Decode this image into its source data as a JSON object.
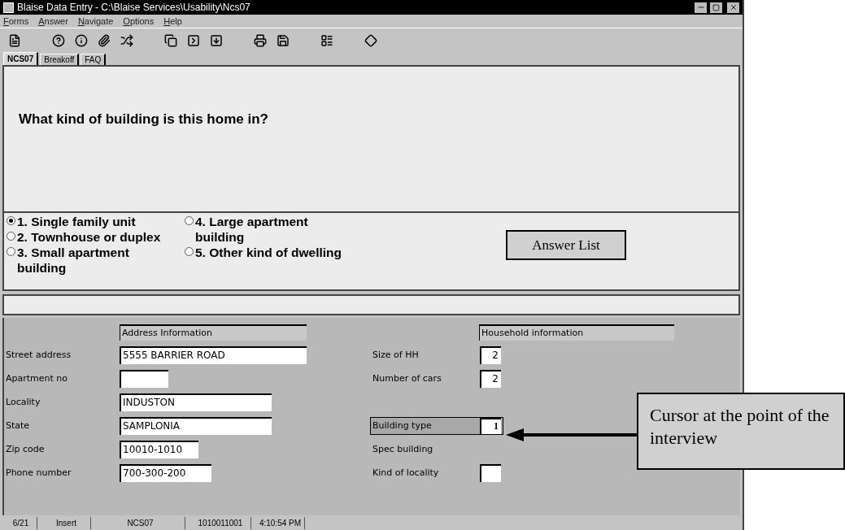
{
  "window": {
    "title": "Blaise Data Entry - C:\\Blaise Services\\Usability\\Ncs07"
  },
  "menu": [
    {
      "label": "Forms"
    },
    {
      "label": "Answer"
    },
    {
      "label": "Navigate"
    },
    {
      "label": "Options"
    },
    {
      "label": "Help"
    }
  ],
  "tabs": [
    {
      "label": "NCS07",
      "selected": true
    },
    {
      "label": "Breakoff",
      "selected": false
    },
    {
      "label": "FAQ",
      "selected": false
    }
  ],
  "question": "What kind of building is this home in?",
  "answer_columns": [
    [
      {
        "label": "1. Single family unit",
        "selected": true
      },
      {
        "label": "2. Townhouse or duplex",
        "selected": false
      },
      {
        "label": "3. Small apartment building",
        "selected": false
      }
    ],
    [
      {
        "label": "4. Large apartment building",
        "selected": false
      },
      {
        "label": "5. Other kind of dwelling",
        "selected": false
      }
    ]
  ],
  "address": {
    "heading": "Address Information",
    "fields": [
      {
        "label": "Street address",
        "value": "5555 BARRIER ROAD"
      },
      {
        "label": "Apartment no"
      },
      {
        "label": "Locality",
        "value": "INDUSTON"
      },
      {
        "label": "State",
        "value": "SAMPLONIA"
      },
      {
        "label": "Zip code",
        "value": "10010-1010"
      },
      {
        "label": "Phone number",
        "value": "700-300-200"
      }
    ]
  },
  "household": {
    "heading": "Household information",
    "groups": [
      [
        {
          "label": "Size of HH",
          "kind": "field",
          "value": "2",
          "current": false
        },
        {
          "label": "Number of cars",
          "kind": "field",
          "value": "2",
          "current": false
        }
      ],
      [
        {
          "label": "Building type",
          "kind": "field",
          "value": "1",
          "current": true
        },
        {
          "label": "Spec building",
          "kind": "label",
          "current": false
        },
        {
          "label": "Kind of locality",
          "kind": "field",
          "current": false
        }
      ]
    ]
  },
  "annotations": {
    "answer_list": "Answer List",
    "cursor": "Cursor at the point of the interview"
  },
  "status_bar": [
    "6/21",
    "Insert",
    "NCS07",
    "1010011001",
    "4:10:54 PM"
  ]
}
